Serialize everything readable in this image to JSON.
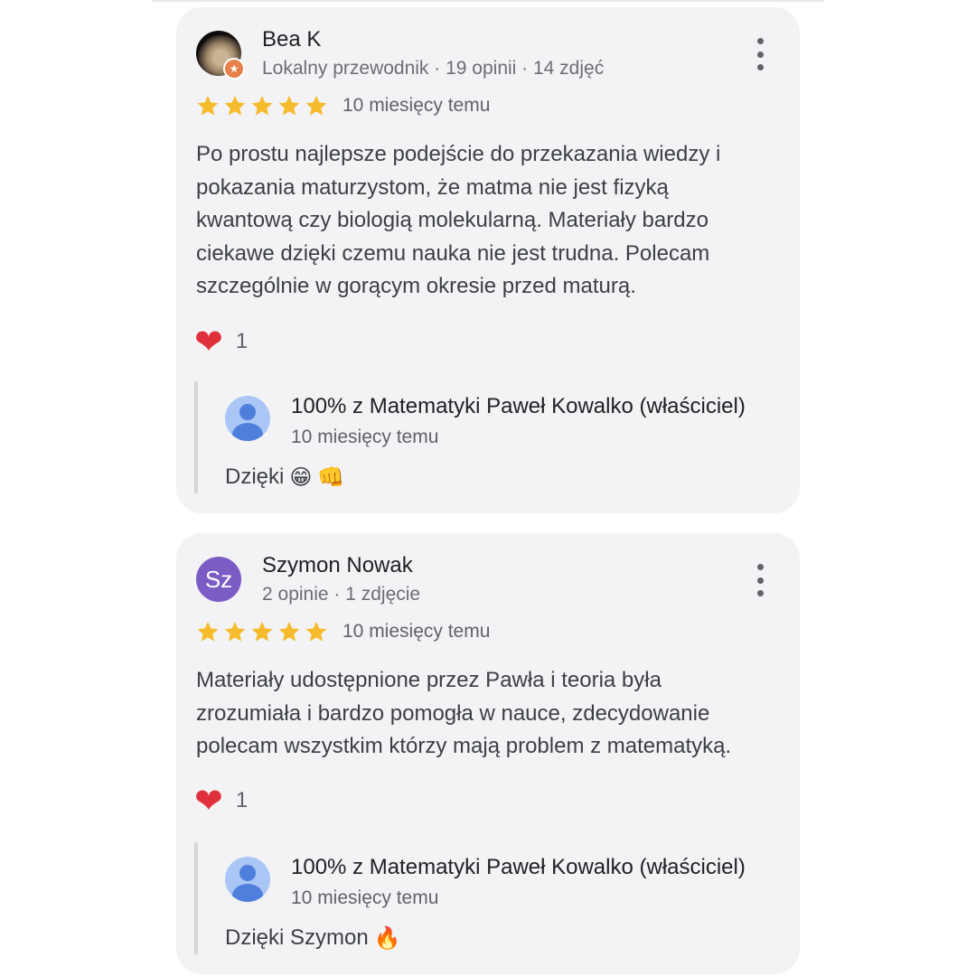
{
  "colors": {
    "star": "#f6bb2c",
    "accent_avatar": "#7b5cc4",
    "heart": "#e0303c"
  },
  "reviews": [
    {
      "reviewer": {
        "name": "Bea K",
        "meta": "Lokalny przewodnik · 19 opinii · 14 zdjęć",
        "avatar_icon": "photo-avatar",
        "badge_icon": "local-guide-star-icon"
      },
      "rating": 5,
      "date": "10 miesięcy temu",
      "text": "Po prostu najlepsze podejście do przekazania wiedzy i\npokazania maturzystom, że matma nie jest fizyką\nkwantową czy biologią molekularną. Materiały bardzo\nciekawe dzięki czemu nauka nie jest trudna. Polecam\nszczególnie w gorącym okresie przed maturą.",
      "reaction": {
        "icon": "heart",
        "count": "1"
      },
      "reply": {
        "owner": "100% z Matematyki Paweł Kowalko (właściciel)",
        "date": "10 miesięcy temu",
        "text": "Dzięki",
        "emojis": [
          "😁",
          "👊"
        ]
      }
    },
    {
      "reviewer": {
        "name": "Szymon Nowak",
        "meta": "2 opinie · 1 zdjęcie",
        "initials": "Sz"
      },
      "rating": 5,
      "date": "10 miesięcy temu",
      "text": "Materiały udostępnione przez Pawła i teoria była\nzrozumiała i bardzo pomogła w nauce, zdecydowanie\npolecam wszystkim którzy mają problem z matematyką.",
      "reaction": {
        "icon": "heart",
        "count": "1"
      },
      "reply": {
        "owner": "100% z Matematyki Paweł Kowalko (właściciel)",
        "date": "10 miesięcy temu",
        "text": "Dzięki Szymon",
        "emojis": [
          "🔥"
        ]
      }
    }
  ]
}
